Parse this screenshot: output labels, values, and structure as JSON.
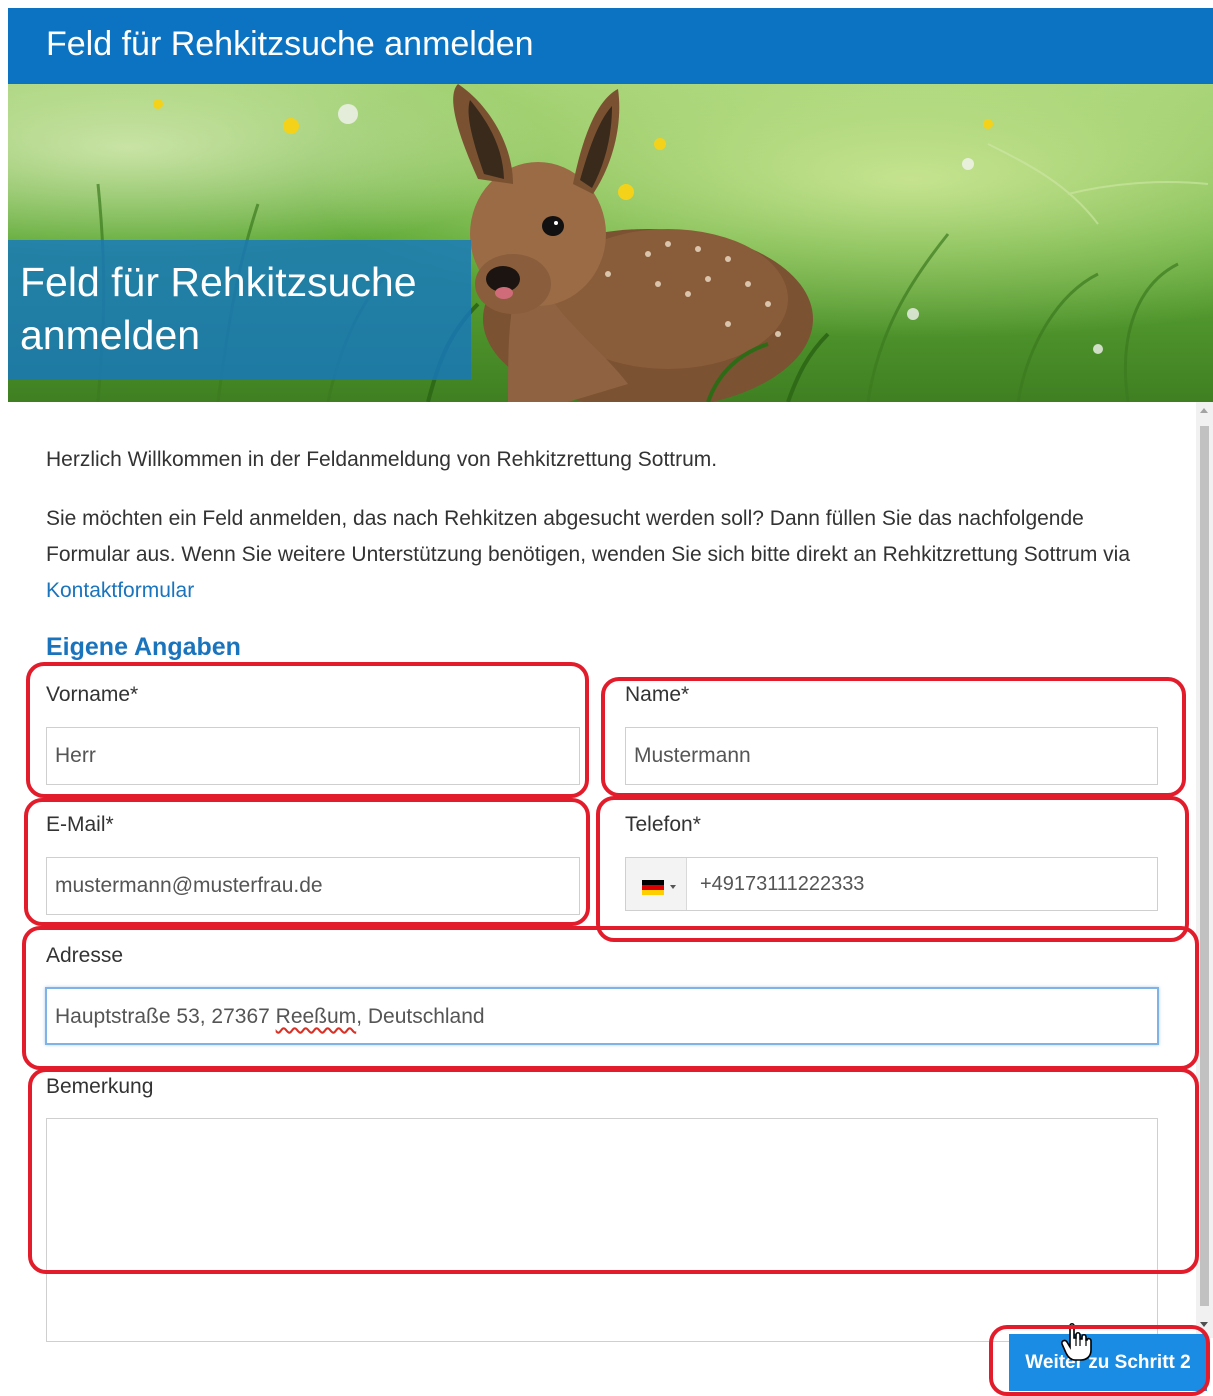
{
  "header": {
    "title": "Feld für Rehkitzsuche anmelden"
  },
  "hero": {
    "caption": "Feld für Rehkitzsuche anmelden"
  },
  "intro": {
    "welcome": "Herzlich Willkommen in der Feldanmeldung von Rehkitzrettung Sottrum.",
    "instructions": "Sie möchten ein Feld anmelden, das nach Rehkitzen abgesucht werden soll? Dann füllen Sie das nachfolgende Formular aus. Wenn Sie weitere Unterstützung benötigen, wenden Sie sich bitte direkt an Rehkitzrettung Sottrum via",
    "contact_link": "Kontaktformular"
  },
  "form": {
    "section_title": "Eigene Angaben",
    "firstname": {
      "label": "Vorname*",
      "value": "Herr"
    },
    "lastname": {
      "label": "Name*",
      "value": "Mustermann"
    },
    "email": {
      "label": "E-Mail*",
      "value": "mustermann@musterfrau.de"
    },
    "phone": {
      "label": "Telefon*",
      "value": "+49173111222333",
      "country_flag": "germany-flag-icon"
    },
    "address": {
      "label": "Adresse",
      "value_before": "Hauptstraße 53, 27367 ",
      "value_misspelled": "Reeßum",
      "value_after": ", Deutschland"
    },
    "remark": {
      "label": "Bemerkung",
      "value": ""
    }
  },
  "actions": {
    "next_label": "Weiter zu Schritt 2"
  },
  "colors": {
    "header_blue": "#0b73c1",
    "link_blue": "#1a74bd",
    "button_blue": "#1a8ce3",
    "annotation_red": "#e21c2a"
  }
}
